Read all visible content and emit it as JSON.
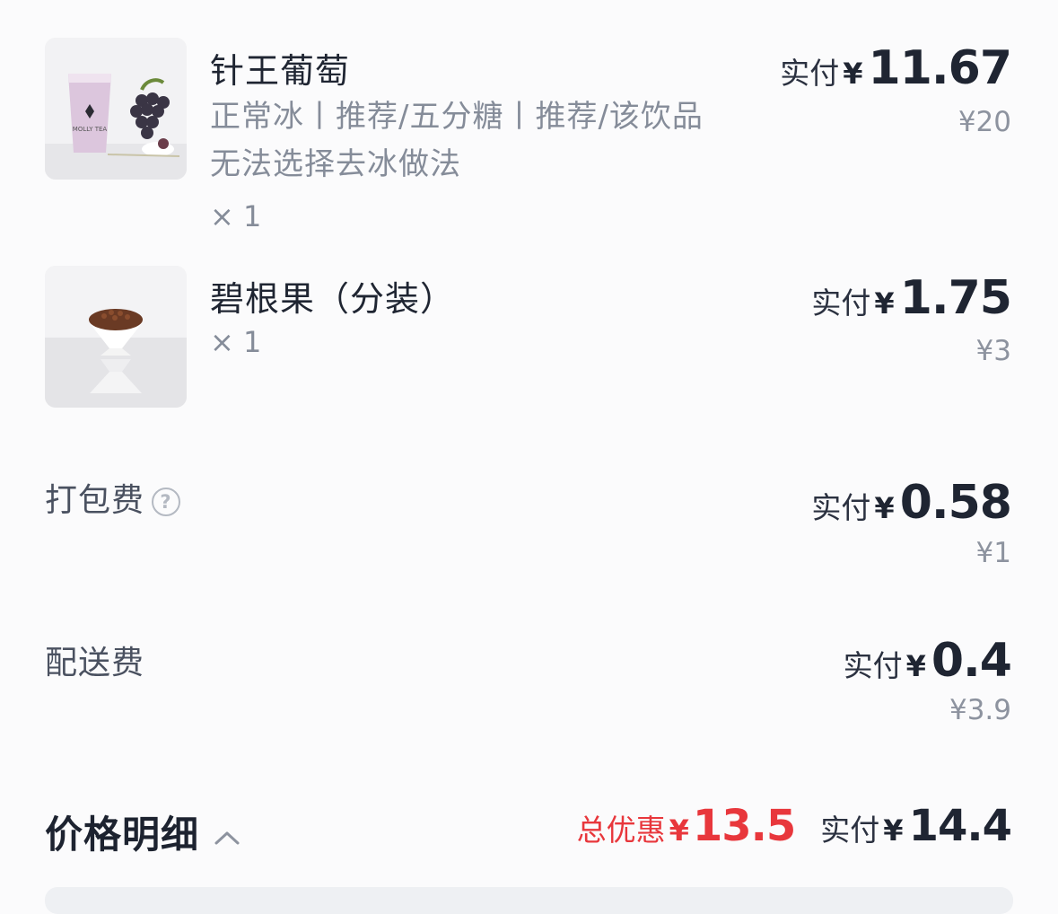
{
  "items": [
    {
      "name": "针王葡萄",
      "spec_line1": "正常冰丨推荐/五分糖丨推荐/该饮品",
      "spec_line2": "无法选择去冰做法",
      "qty": "× 1",
      "pay_label": "实付",
      "currency": "¥",
      "pay_amount": "11.67",
      "orig_price": "¥20",
      "image_icon": "grape-tea-cup-image"
    },
    {
      "name": "碧根果（分装）",
      "qty": "× 1",
      "pay_label": "实付",
      "currency": "¥",
      "pay_amount": "1.75",
      "orig_price": "¥3",
      "image_icon": "pecan-cup-image"
    }
  ],
  "fees": [
    {
      "label": "打包费",
      "help_icon": "?",
      "pay_label": "实付",
      "currency": "¥",
      "pay_amount": "0.58",
      "orig_price": "¥1"
    },
    {
      "label": "配送费",
      "pay_label": "实付",
      "currency": "¥",
      "pay_amount": "0.4",
      "orig_price": "¥3.9"
    }
  ],
  "summary": {
    "title": "价格明细",
    "discount_label": "总优惠",
    "discount_currency": "¥",
    "discount_amount": "13.5",
    "pay_label": "实付",
    "currency": "¥",
    "pay_amount": "14.4"
  },
  "colors": {
    "discount": "#e8373c",
    "text_primary": "#1f2532",
    "text_secondary": "#858c99"
  }
}
